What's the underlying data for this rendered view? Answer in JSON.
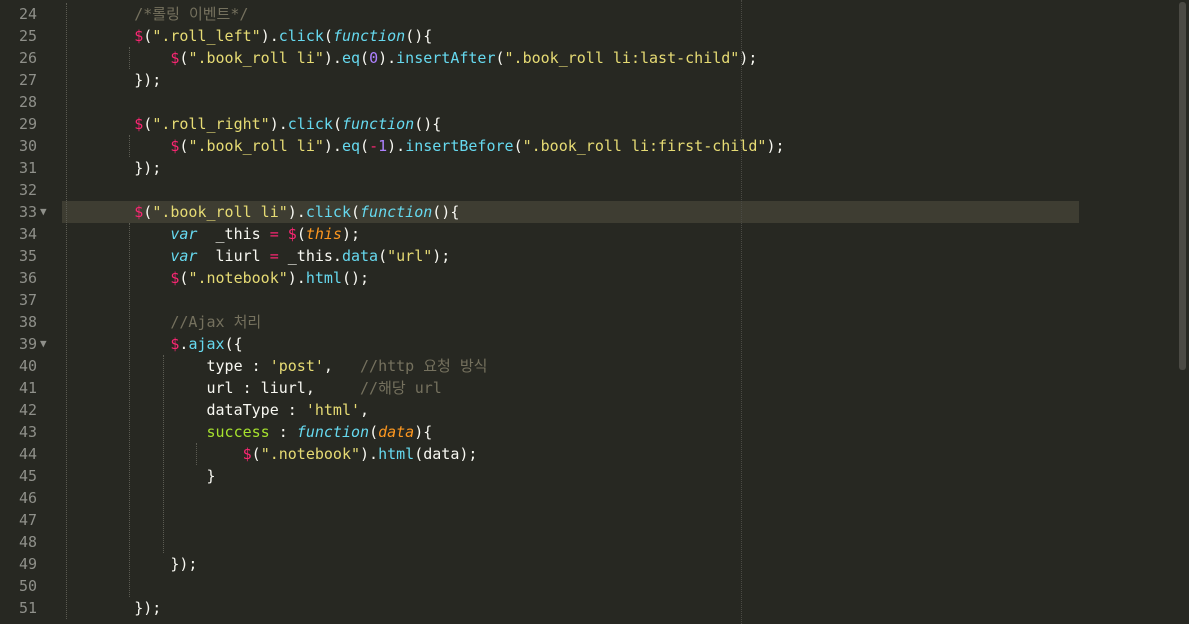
{
  "editor": {
    "theme": "monokai",
    "colors": {
      "background": "#272822",
      "active_line": "#3e3d32",
      "comment": "#75715e",
      "string": "#e6db74",
      "keyword": "#66d9ef",
      "operator": "#f92672",
      "number": "#ae81ff",
      "parameter": "#fd971f",
      "property": "#a6e22e"
    },
    "active_line": "33",
    "lines": [
      {
        "n": "24",
        "fold": "",
        "tokens": [
          [
            "pl",
            "        "
          ],
          [
            "cm",
            "/*롤링 이벤트*/"
          ]
        ]
      },
      {
        "n": "25",
        "fold": "",
        "tokens": [
          [
            "pl",
            "        "
          ],
          [
            "op",
            "$"
          ],
          [
            "pl",
            "("
          ],
          [
            "st",
            "\".roll_left\""
          ],
          [
            "pl",
            ")."
          ],
          [
            "fn",
            "click"
          ],
          [
            "pl",
            "("
          ],
          [
            "kw",
            "function"
          ],
          [
            "pl",
            "(){"
          ]
        ]
      },
      {
        "n": "26",
        "fold": "",
        "tokens": [
          [
            "pl",
            "            "
          ],
          [
            "op",
            "$"
          ],
          [
            "pl",
            "("
          ],
          [
            "st",
            "\".book_roll li\""
          ],
          [
            "pl",
            ")."
          ],
          [
            "fn",
            "eq"
          ],
          [
            "pl",
            "("
          ],
          [
            "nu",
            "0"
          ],
          [
            "pl",
            ")."
          ],
          [
            "fn",
            "insertAfter"
          ],
          [
            "pl",
            "("
          ],
          [
            "st",
            "\".book_roll li:last-child\""
          ],
          [
            "pl",
            ");"
          ]
        ]
      },
      {
        "n": "27",
        "fold": "",
        "tokens": [
          [
            "pl",
            "        });"
          ]
        ]
      },
      {
        "n": "28",
        "fold": "",
        "tokens": []
      },
      {
        "n": "29",
        "fold": "",
        "tokens": [
          [
            "pl",
            "        "
          ],
          [
            "op",
            "$"
          ],
          [
            "pl",
            "("
          ],
          [
            "st",
            "\".roll_right\""
          ],
          [
            "pl",
            ")."
          ],
          [
            "fn",
            "click"
          ],
          [
            "pl",
            "("
          ],
          [
            "kw",
            "function"
          ],
          [
            "pl",
            "(){"
          ]
        ]
      },
      {
        "n": "30",
        "fold": "",
        "tokens": [
          [
            "pl",
            "            "
          ],
          [
            "op",
            "$"
          ],
          [
            "pl",
            "("
          ],
          [
            "st",
            "\".book_roll li\""
          ],
          [
            "pl",
            ")."
          ],
          [
            "fn",
            "eq"
          ],
          [
            "pl",
            "("
          ],
          [
            "op",
            "-"
          ],
          [
            "nu",
            "1"
          ],
          [
            "pl",
            ")."
          ],
          [
            "fn",
            "insertBefore"
          ],
          [
            "pl",
            "("
          ],
          [
            "st",
            "\".book_roll li:first-child\""
          ],
          [
            "pl",
            ");"
          ]
        ]
      },
      {
        "n": "31",
        "fold": "",
        "tokens": [
          [
            "pl",
            "        });"
          ]
        ]
      },
      {
        "n": "32",
        "fold": "",
        "tokens": []
      },
      {
        "n": "33",
        "fold": "▼",
        "tokens": [
          [
            "pl",
            "        "
          ],
          [
            "op",
            "$"
          ],
          [
            "pl",
            "("
          ],
          [
            "st",
            "\".book_roll li\""
          ],
          [
            "pl",
            ")."
          ],
          [
            "fn",
            "click"
          ],
          [
            "pl",
            "("
          ],
          [
            "kw",
            "function"
          ],
          [
            "pl",
            "(){"
          ]
        ]
      },
      {
        "n": "34",
        "fold": "",
        "tokens": [
          [
            "pl",
            "            "
          ],
          [
            "kw",
            "var"
          ],
          [
            "pl",
            "  _this "
          ],
          [
            "op",
            "="
          ],
          [
            "pl",
            " "
          ],
          [
            "op",
            "$"
          ],
          [
            "pl",
            "("
          ],
          [
            "pa",
            "this"
          ],
          [
            "pl",
            ");"
          ]
        ]
      },
      {
        "n": "35",
        "fold": "",
        "tokens": [
          [
            "pl",
            "            "
          ],
          [
            "kw",
            "var"
          ],
          [
            "pl",
            "  liurl "
          ],
          [
            "op",
            "="
          ],
          [
            "pl",
            " _this."
          ],
          [
            "fn",
            "data"
          ],
          [
            "pl",
            "("
          ],
          [
            "st",
            "\"url\""
          ],
          [
            "pl",
            ");"
          ]
        ]
      },
      {
        "n": "36",
        "fold": "",
        "tokens": [
          [
            "pl",
            "            "
          ],
          [
            "op",
            "$"
          ],
          [
            "pl",
            "("
          ],
          [
            "st",
            "\".notebook\""
          ],
          [
            "pl",
            ")."
          ],
          [
            "fn",
            "html"
          ],
          [
            "pl",
            "();"
          ]
        ]
      },
      {
        "n": "37",
        "fold": "",
        "tokens": []
      },
      {
        "n": "38",
        "fold": "",
        "tokens": [
          [
            "pl",
            "            "
          ],
          [
            "cm",
            "//Ajax 처리"
          ]
        ]
      },
      {
        "n": "39",
        "fold": "▼",
        "tokens": [
          [
            "pl",
            "            "
          ],
          [
            "op",
            "$"
          ],
          [
            "pl",
            "."
          ],
          [
            "fn",
            "ajax"
          ],
          [
            "pl",
            "({"
          ]
        ]
      },
      {
        "n": "40",
        "fold": "",
        "tokens": [
          [
            "pl",
            "                type : "
          ],
          [
            "st",
            "'post'"
          ],
          [
            "pl",
            ",   "
          ],
          [
            "cm",
            "//http 요청 방식"
          ]
        ]
      },
      {
        "n": "41",
        "fold": "",
        "tokens": [
          [
            "pl",
            "                url : liurl,     "
          ],
          [
            "cm",
            "//해당 url"
          ]
        ]
      },
      {
        "n": "42",
        "fold": "",
        "tokens": [
          [
            "pl",
            "                dataType : "
          ],
          [
            "st",
            "'html'"
          ],
          [
            "pl",
            ","
          ]
        ]
      },
      {
        "n": "43",
        "fold": "",
        "tokens": [
          [
            "pl",
            "                "
          ],
          [
            "gr",
            "success"
          ],
          [
            "pl",
            " : "
          ],
          [
            "kw",
            "function"
          ],
          [
            "pl",
            "("
          ],
          [
            "pa",
            "data"
          ],
          [
            "pl",
            "){"
          ]
        ]
      },
      {
        "n": "44",
        "fold": "",
        "tokens": [
          [
            "pl",
            "                    "
          ],
          [
            "op",
            "$"
          ],
          [
            "pl",
            "("
          ],
          [
            "st",
            "\".notebook\""
          ],
          [
            "pl",
            ")."
          ],
          [
            "fn",
            "html"
          ],
          [
            "pl",
            "(data);"
          ]
        ]
      },
      {
        "n": "45",
        "fold": "",
        "tokens": [
          [
            "pl",
            "                }"
          ]
        ]
      },
      {
        "n": "46",
        "fold": "",
        "tokens": []
      },
      {
        "n": "47",
        "fold": "",
        "tokens": []
      },
      {
        "n": "48",
        "fold": "",
        "tokens": []
      },
      {
        "n": "49",
        "fold": "",
        "tokens": [
          [
            "pl",
            "            });"
          ]
        ]
      },
      {
        "n": "50",
        "fold": "",
        "tokens": []
      },
      {
        "n": "51",
        "fold": "",
        "tokens": [
          [
            "pl",
            "        });"
          ]
        ]
      }
    ]
  }
}
